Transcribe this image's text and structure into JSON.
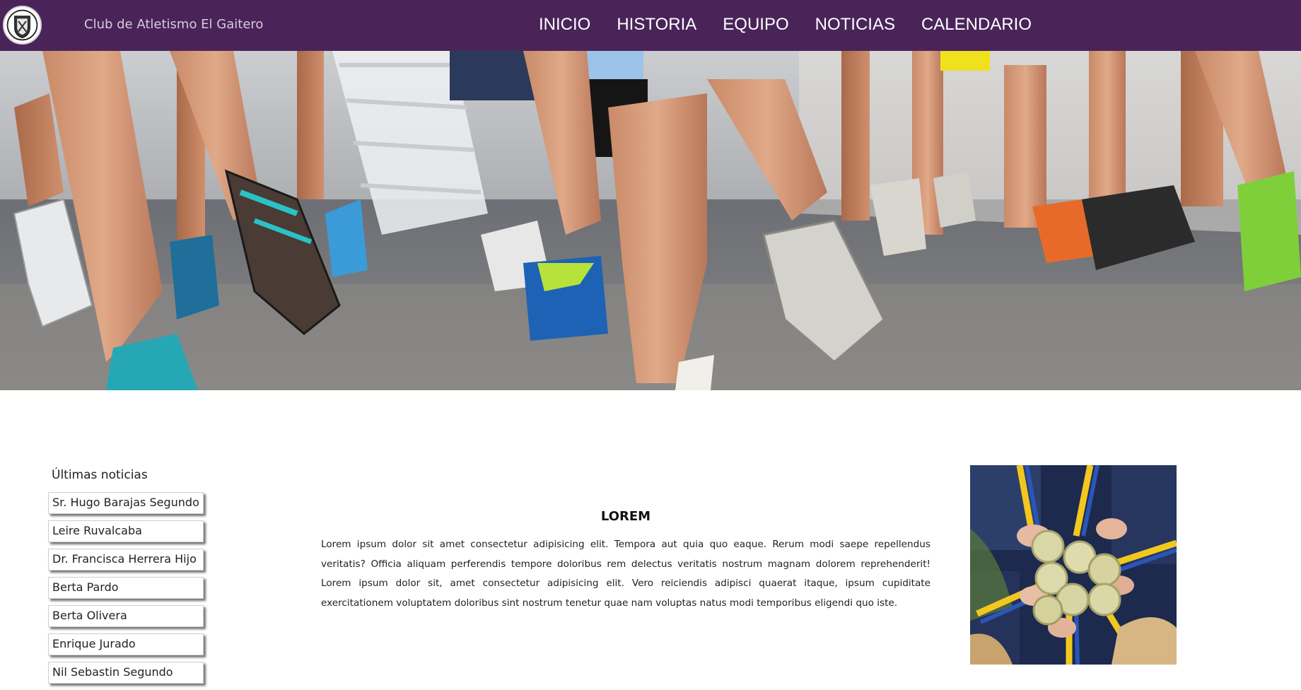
{
  "header": {
    "site_title": "Club de Atletismo El Gaitero",
    "logo_icon": "club-crest-icon",
    "nav": [
      {
        "label": "INICIO"
      },
      {
        "label": "HISTORIA"
      },
      {
        "label": "EQUIPO"
      },
      {
        "label": "NOTICIAS"
      },
      {
        "label": "CALENDARIO"
      }
    ]
  },
  "sidebar": {
    "title": "Últimas noticias",
    "items": [
      {
        "label": "Sr. Hugo Barajas Segundo"
      },
      {
        "label": "Leire Ruvalcaba"
      },
      {
        "label": "Dr. Francisca Herrera Hijo"
      },
      {
        "label": "Berta Pardo"
      },
      {
        "label": "Berta Olivera"
      },
      {
        "label": "Enrique Jurado"
      },
      {
        "label": "Nil Sebastin Segundo"
      }
    ]
  },
  "article": {
    "title": "LOREM",
    "body": "Lorem ipsum dolor sit amet consectetur adipisicing elit. Tempora aut quia quo eaque. Rerum modi saepe repellendus veritatis? Officia aliquam perferendis tempore doloribus rem delectus veritatis nostrum magnam dolorem reprehenderit! Lorem ipsum dolor sit, amet consectetur adipisicing elit. Vero reiciendis adipisci quaerat itaque, ipsum cupiditate exercitationem voluptatem doloribus sint nostrum tenetur quae nam voluptas natus modi temporibus eligendi quo iste."
  },
  "colors": {
    "header_bg": "#4a2459",
    "nav_text": "#ffffff",
    "title_text": "#d8cade"
  },
  "images": {
    "hero": "runners-legs-photo",
    "side": "medals-photo"
  }
}
